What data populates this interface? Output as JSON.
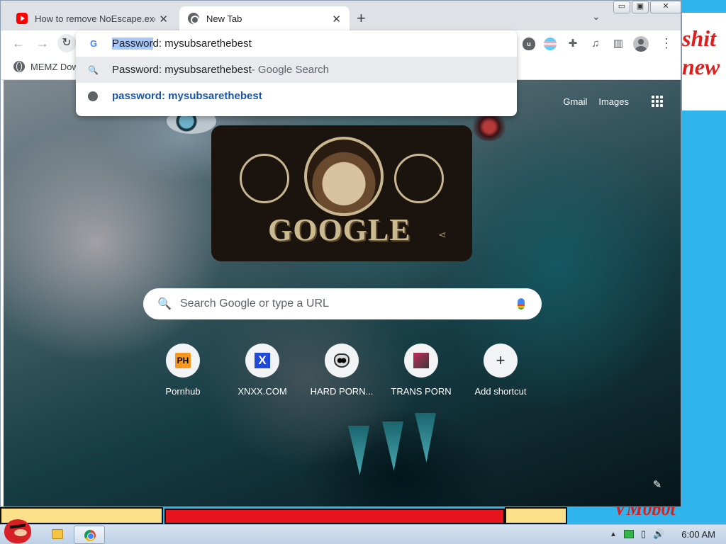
{
  "desktop": {
    "note_lines": [
      "shit",
      "new"
    ],
    "signature": "VM0b0t"
  },
  "tabs": [
    {
      "title": "How to remove NoEscape.exe",
      "icon": "youtube-icon"
    },
    {
      "title": "New Tab",
      "icon": "chrome-icon"
    }
  ],
  "window_controls": {
    "minimize": "▭",
    "restore": "▣",
    "close": "✕"
  },
  "toolbar": {
    "back": "←",
    "forward": "→",
    "reload": "↻",
    "extensions": [
      "ublock-icon",
      "trans-flag-icon",
      "puzzle-icon",
      "media-icon",
      "side-panel-icon"
    ],
    "menu": "⋮"
  },
  "bookmarks": [
    {
      "label": "MEMZ Dow"
    }
  ],
  "omnibox": {
    "input_selected": "Passwor",
    "input_rest": "d: mysubsarethebest",
    "suggestions": [
      {
        "text": "Password: mysubsarethebest",
        "suffix": " - Google Search",
        "icon": "search-icon"
      },
      {
        "text": "password: mysubsarethebest",
        "icon": "globe-icon"
      }
    ]
  },
  "ntp": {
    "top_links": [
      "Gmail",
      "Images"
    ],
    "doodle_text": "GOOGLE",
    "search_placeholder": "Search Google or type a URL",
    "shortcuts": [
      {
        "label": "Pornhub",
        "icon": "PH"
      },
      {
        "label": "XNXX.COM",
        "icon": "X"
      },
      {
        "label": "HARD PORN...",
        "icon": "hard-porn-icon"
      },
      {
        "label": "TRANS PORN",
        "icon": "trans-porn-icon"
      },
      {
        "label": "Add shortcut",
        "icon": "+"
      }
    ]
  },
  "taskbar": {
    "time": "6:00 AM"
  }
}
